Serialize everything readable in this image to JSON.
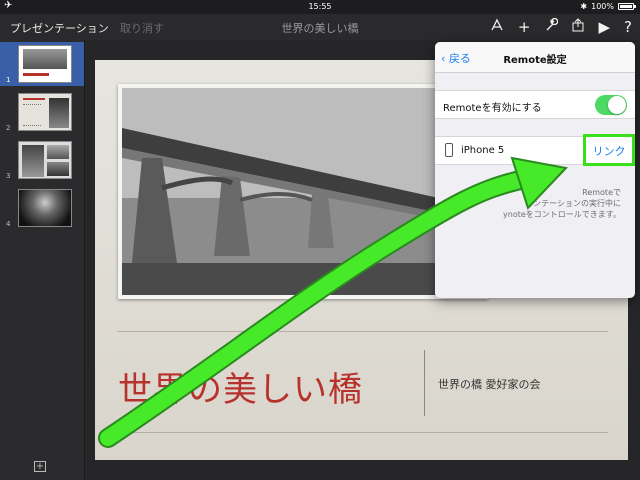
{
  "statusbar": {
    "time": "15:55",
    "battery": "100%"
  },
  "toolbar": {
    "back_label": "プレゼンテーション",
    "undo_label": "取り消す",
    "document_title": "世界の美しい橋",
    "icons": [
      "format-brush-icon",
      "add-icon",
      "wrench-icon",
      "share-icon",
      "play-icon",
      "help-icon"
    ],
    "help_label": "?"
  },
  "slides": [
    {
      "number": "1",
      "selected": true
    },
    {
      "number": "2"
    },
    {
      "number": "3"
    },
    {
      "number": "4"
    }
  ],
  "slide": {
    "title": "世界の美しい橋",
    "subtitle": "世界の橋 愛好家の会",
    "title_color": "#b8322c"
  },
  "popover": {
    "back_label": "戻る",
    "title": "Remote設定",
    "enable_label": "Remoteを有効にする",
    "enable_on": true,
    "device_name": "iPhone 5",
    "link_label": "リンク",
    "note_lines": [
      "Remoteで",
      "ンテーションの実行中に",
      "ynoteをコントロールできます。"
    ]
  },
  "colors": {
    "accent": "#1a7cf5",
    "toggle": "#4cd964",
    "highlight": "#39e01a"
  }
}
